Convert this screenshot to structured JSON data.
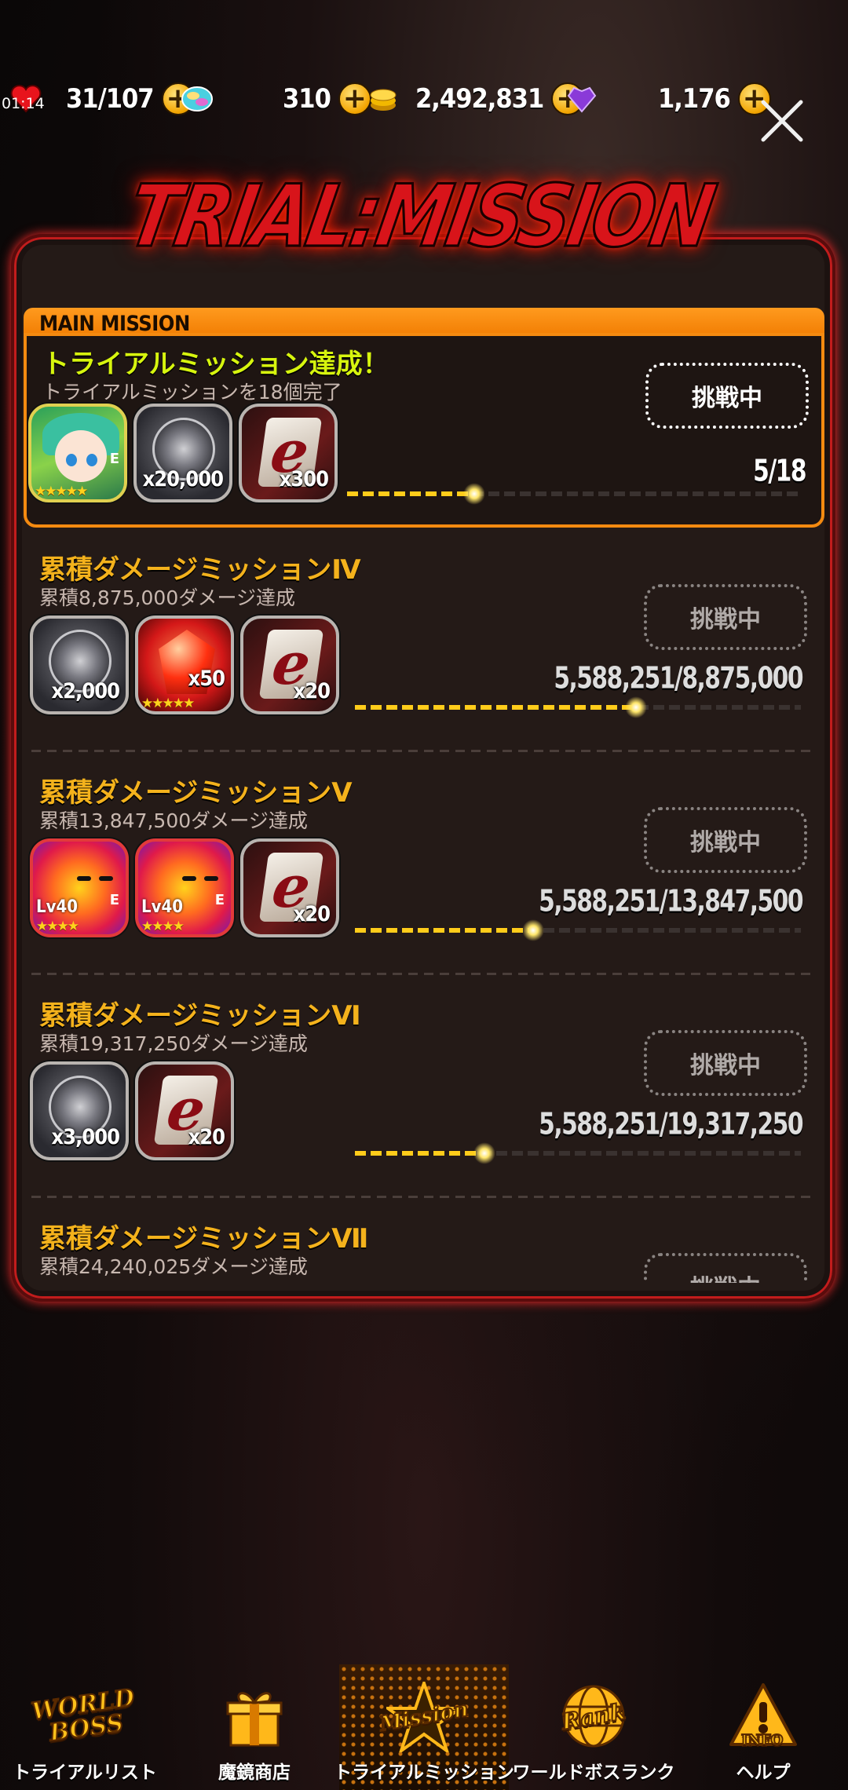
{
  "status": {
    "clock": "01:14"
  },
  "resources": {
    "stamina": "31/107",
    "gems": "310",
    "gold": "2,492,831",
    "hearts": "1,176"
  },
  "header": {
    "title": "TRIAL:MISSION"
  },
  "main_mission": {
    "header_label": "MAIN MISSION",
    "title": "トライアルミッション達成！",
    "description": "トライアルミッションを18個完了",
    "status_button": "挑戦中",
    "progress_text": "5/18",
    "progress": 0.28,
    "rewards": [
      {
        "type": "character",
        "stars": "★★★★★"
      },
      {
        "type": "coin",
        "qty": "x20,000"
      },
      {
        "type": "ticket",
        "qty": "x300"
      }
    ]
  },
  "missions": [
    {
      "title": "累積ダメージミッションⅣ",
      "description": "累積8,875,000ダメージ達成",
      "status_button": "挑戦中",
      "progress_text": "5,588,251/8,875,000",
      "progress": 0.63,
      "rewards": [
        {
          "type": "coin",
          "qty": "x2,000"
        },
        {
          "type": "gem-red",
          "qty": "x50",
          "stars": "★★★★★"
        },
        {
          "type": "ticket",
          "qty": "x20"
        }
      ]
    },
    {
      "title": "累積ダメージミッションⅤ",
      "description": "累積13,847,500ダメージ達成",
      "status_button": "挑戦中",
      "progress_text": "5,588,251/13,847,500",
      "progress": 0.4,
      "rewards": [
        {
          "type": "slime",
          "level": "Lv40",
          "stars": "★★★★"
        },
        {
          "type": "slime",
          "level": "Lv40",
          "stars": "★★★★"
        },
        {
          "type": "ticket",
          "qty": "x20"
        }
      ]
    },
    {
      "title": "累積ダメージミッションⅥ",
      "description": "累積19,317,250ダメージ達成",
      "status_button": "挑戦中",
      "progress_text": "5,588,251/19,317,250",
      "progress": 0.29,
      "rewards": [
        {
          "type": "coin",
          "qty": "x3,000"
        },
        {
          "type": "ticket",
          "qty": "x20"
        }
      ]
    },
    {
      "title": "累積ダメージミッションⅦ",
      "description": "累積24,240,025ダメージ達成",
      "status_button": "挑戦中"
    }
  ],
  "nav": [
    {
      "label": "トライアルリスト",
      "icon": "world-boss-icon",
      "logo": "WORLD BOSS"
    },
    {
      "label": "魔鏡商店",
      "icon": "gift-icon"
    },
    {
      "label": "トライアルミッション",
      "icon": "mission-star-icon",
      "logo": "Mission",
      "active": true
    },
    {
      "label": "ワールドボスランク",
      "icon": "rank-globe-icon",
      "logo": "Rank"
    },
    {
      "label": "ヘルプ",
      "icon": "info-icon",
      "logo": "INFO"
    }
  ]
}
